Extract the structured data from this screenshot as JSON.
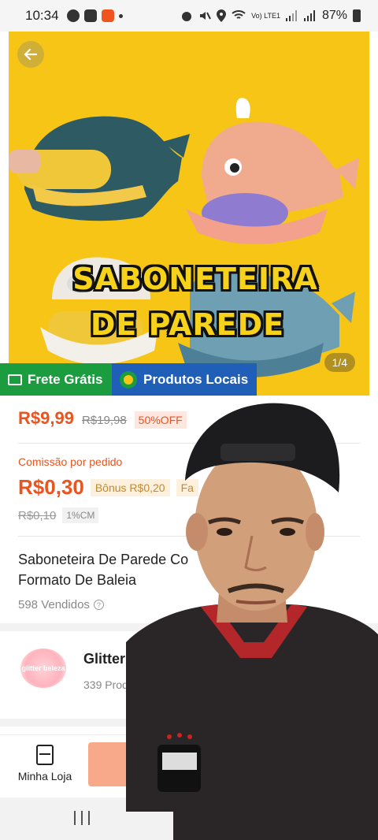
{
  "status_bar": {
    "time": "10:34",
    "network": "Vo) LTE1",
    "battery": "87%"
  },
  "product_image": {
    "overlay_line1": "SABONETEIRA",
    "overlay_line2": "DE PAREDE",
    "counter": "1/4",
    "background_color": "#f6c516"
  },
  "badges": {
    "free_shipping": "Frete Grátis",
    "local_products": "Produtos Locais"
  },
  "pricing": {
    "price": "R$9,99",
    "old_price": "R$19,98",
    "discount": "50%OFF",
    "commission_label": "Comissão por pedido",
    "commission_value": "R$0,30",
    "bonus": "Bônus R$0,20",
    "bonus_extra": "Fa",
    "commission_old": "R$0,10",
    "cm_tag": "1%CM"
  },
  "product": {
    "title": "Saboneteira De Parede Co\nFormato De Baleia",
    "sold": "598 Vendidos",
    "help_glyph": "?"
  },
  "store": {
    "logo_text": "glitter beleza",
    "name": "Glitter",
    "meta": "339 Prod"
  },
  "bottom_bar": {
    "my_store": "Minha Loja"
  },
  "colors": {
    "accent": "#e9541f",
    "green_badge": "#1a9c3f",
    "blue_badge": "#1f5fb8"
  }
}
